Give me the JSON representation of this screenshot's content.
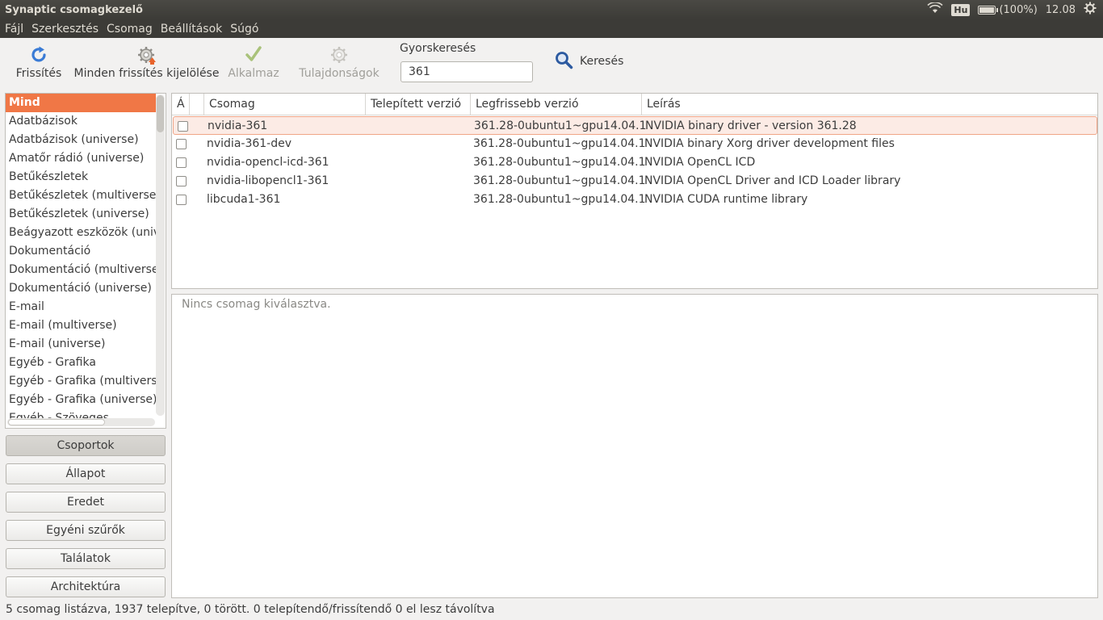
{
  "panel": {
    "title": "Synaptic csomagkezelő",
    "keyboard": "Hu",
    "battery": "(100%)",
    "battery_level": 1.0,
    "clock": "12.08"
  },
  "menu": [
    "Fájl",
    "Szerkesztés",
    "Csomag",
    "Beállítások",
    "Súgó"
  ],
  "toolbar": {
    "refresh": "Frissítés",
    "mark_all": "Minden frissítés kijelölése",
    "apply": "Alkalmaz",
    "properties": "Tulajdonságok",
    "quick_search_label": "Gyorskeresés",
    "quick_search_value": "361",
    "search": "Keresés"
  },
  "categories": [
    "Mind",
    "Adatbázisok",
    "Adatbázisok (universe)",
    "Amatőr rádió (universe)",
    "Betűkészletek",
    "Betűkészletek (multiverse)",
    "Betűkészletek (universe)",
    "Beágyazott eszközök (universe)",
    "Dokumentáció",
    "Dokumentáció (multiverse)",
    "Dokumentáció (universe)",
    "E-mail",
    "E-mail (multiverse)",
    "E-mail (universe)",
    "Egyéb - Grafika",
    "Egyéb - Grafika (multiverse)",
    "Egyéb - Grafika (universe)",
    "Egyéb - Szöveges"
  ],
  "filters": [
    "Csoportok",
    "Állapot",
    "Eredet",
    "Egyéni szűrők",
    "Találatok",
    "Architektúra"
  ],
  "table": {
    "headers": [
      "Á",
      "Csomag",
      "Telepített verzió",
      "Legfrissebb verzió",
      "Leírás"
    ],
    "rows": [
      {
        "name": "nvidia-361",
        "installed": "",
        "latest": "361.28-0ubuntu1~gpu14.04.1",
        "desc": "NVIDIA binary driver - version 361.28"
      },
      {
        "name": "nvidia-361-dev",
        "installed": "",
        "latest": "361.28-0ubuntu1~gpu14.04.1",
        "desc": "NVIDIA binary Xorg driver development files"
      },
      {
        "name": "nvidia-opencl-icd-361",
        "installed": "",
        "latest": "361.28-0ubuntu1~gpu14.04.1",
        "desc": "NVIDIA OpenCL ICD"
      },
      {
        "name": "nvidia-libopencl1-361",
        "installed": "",
        "latest": "361.28-0ubuntu1~gpu14.04.1",
        "desc": "NVIDIA OpenCL Driver and ICD Loader library"
      },
      {
        "name": "libcuda1-361",
        "installed": "",
        "latest": "361.28-0ubuntu1~gpu14.04.1",
        "desc": "NVIDIA CUDA runtime library"
      }
    ]
  },
  "details": "Nincs csomag kiválasztva.",
  "status": "5 csomag listázva, 1937 telepítve, 0 törött. 0 telepítendő/frissítendő 0 el lesz távolítva",
  "colors": {
    "accent": "#f07746",
    "panel": "#3c3b37",
    "window": "#f2f1f0"
  }
}
